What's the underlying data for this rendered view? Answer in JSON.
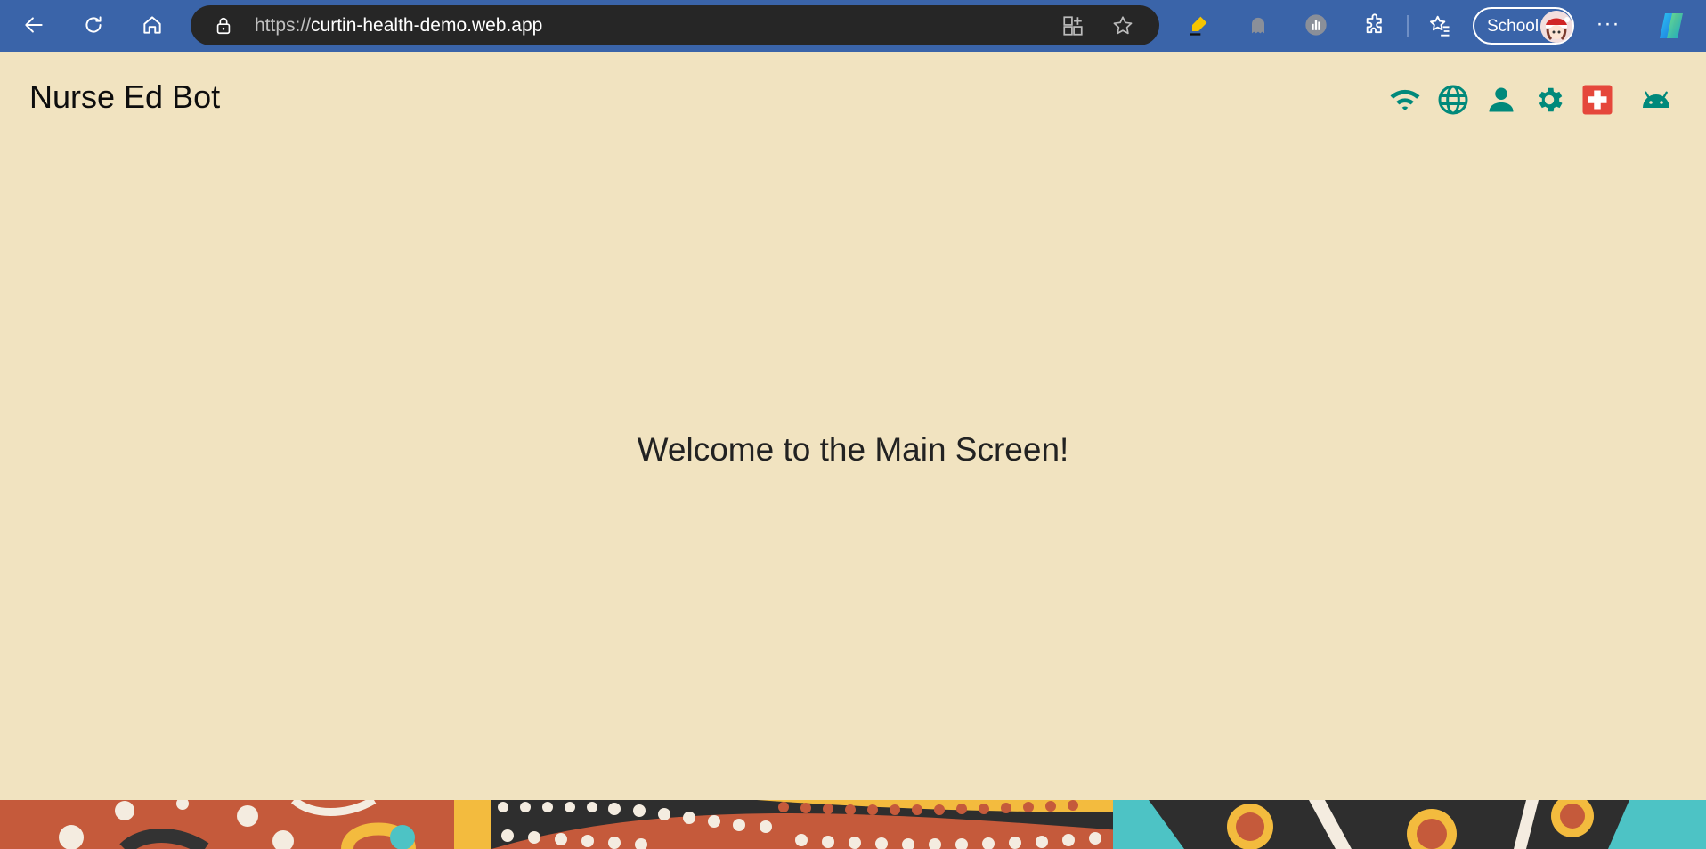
{
  "browser": {
    "url_scheme": "https://",
    "url_host": "curtin-health-demo.web.app",
    "profile_label": "School",
    "more_label": "···"
  },
  "app": {
    "title": "Nurse Ed Bot",
    "accent_color": "#00897b",
    "medical_icon_color": "#e5473b",
    "background_color": "#f1e3c0",
    "header_icons": [
      "wifi-icon",
      "globe-icon",
      "person-icon",
      "gear-icon",
      "medical-cross-icon",
      "android-icon"
    ]
  },
  "main": {
    "welcome_text": "Welcome to the Main Screen!"
  }
}
